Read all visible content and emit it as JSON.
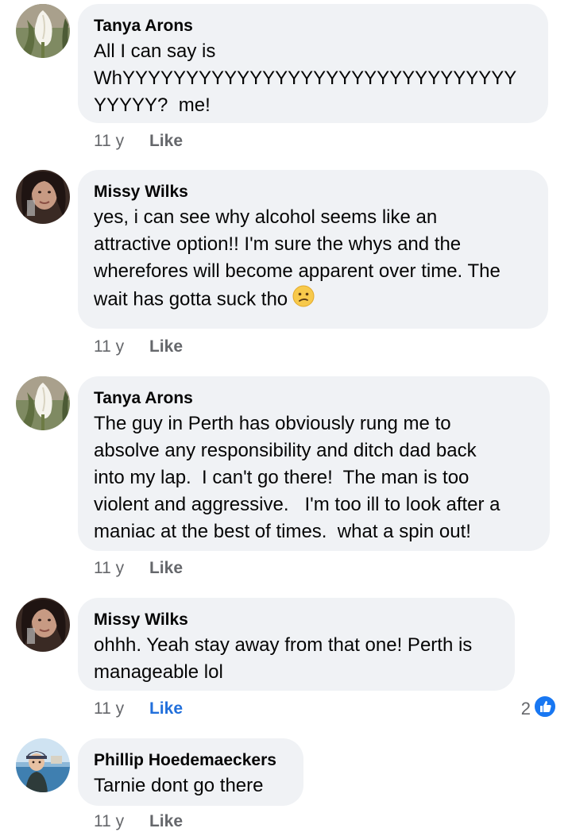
{
  "comments": [
    {
      "author": "Tanya Arons",
      "text": "All I can say is\nWhYYYYYYYYYYYYYYYYYYYYYYYYYYYYYYY\nYYYYY?  me!",
      "time": "11 y",
      "like": "Like",
      "avatar_icon": "white-calla-lily-avatar-icon"
    },
    {
      "author": "Missy Wilks",
      "text": "yes, i can see why alcohol seems like an\nattractive option!! I'm sure the whys and the\nwherefores will become apparent over time. The\nwait has gotta suck tho",
      "emoji": "confused-face-emoji",
      "time": "11 y",
      "like": "Like",
      "avatar_icon": "woman-portrait-avatar-icon"
    },
    {
      "author": "Tanya Arons",
      "text": "The guy in Perth has obviously rung me to\nabsolve any responsibility and ditch dad back\ninto my lap.  I can't go there!  The man is too\nviolent and aggressive.   I'm too ill to look after a\nmaniac at the best of times.  what a spin out!",
      "time": "11 y",
      "like": "Like",
      "avatar_icon": "white-calla-lily-avatar-icon"
    },
    {
      "author": "Missy Wilks",
      "text": "ohhh. Yeah stay away from that one! Perth is\nmanageable lol",
      "time": "11 y",
      "like": "Like",
      "like_active": true,
      "reaction_count": "2",
      "reaction_icon": "thumbs-up-reaction-icon",
      "avatar_icon": "woman-portrait-avatar-icon"
    },
    {
      "author": "Phillip Hoedemaeckers",
      "text": "Tarnie dont go there",
      "time": "11 y",
      "like": "Like",
      "avatar_icon": "child-beach-avatar-icon"
    }
  ],
  "colors": {
    "bubble": "#f0f2f5",
    "meta_text": "#65676b",
    "like_active": "#216fdb"
  }
}
